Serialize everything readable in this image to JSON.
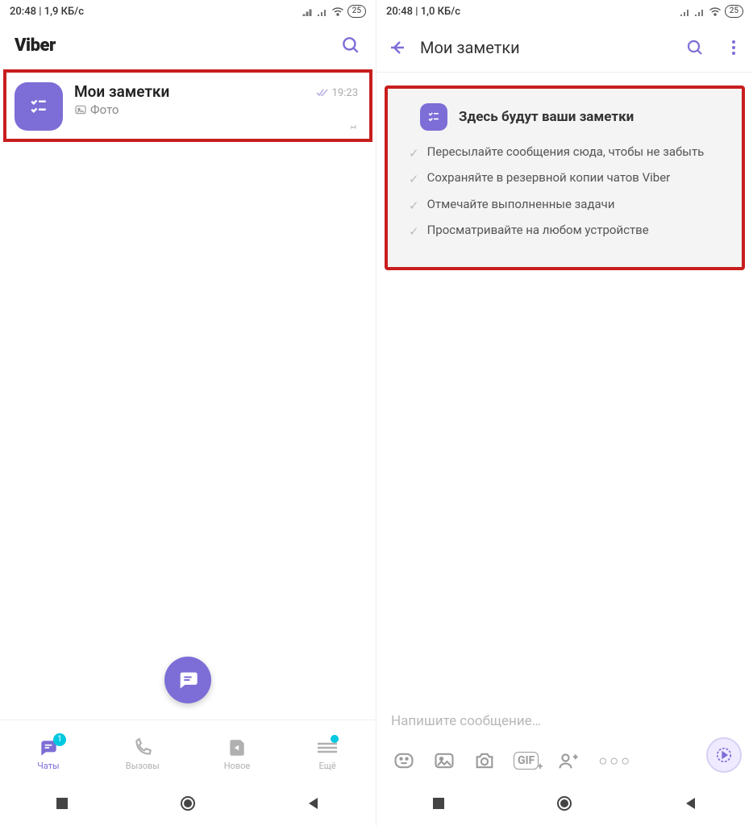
{
  "left": {
    "status": {
      "time": "20:48",
      "speed": "1,9 КБ/с",
      "battery": "25"
    },
    "brand": "Viber",
    "chat": {
      "title": "Мои заметки",
      "subtitle": "Фото",
      "time": "19:23"
    },
    "nav": {
      "chats": {
        "label": "Чаты",
        "badge": "1"
      },
      "calls": {
        "label": "Вызовы"
      },
      "new": {
        "label": "Новое"
      },
      "more": {
        "label": "Ещё"
      }
    }
  },
  "right": {
    "status": {
      "time": "20:48",
      "speed": "1,0 КБ/с",
      "battery": "25"
    },
    "title": "Мои заметки",
    "card": {
      "heading": "Здесь будут ваши заметки",
      "items": [
        "Пересылайте сообщения сюда, чтобы не забыть",
        "Сохраняйте в резервной копии чатов Viber",
        "Отмечайте выполненные задачи",
        "Просматривайте на любом устройстве"
      ]
    },
    "compose_placeholder": "Напишите сообщение…"
  }
}
